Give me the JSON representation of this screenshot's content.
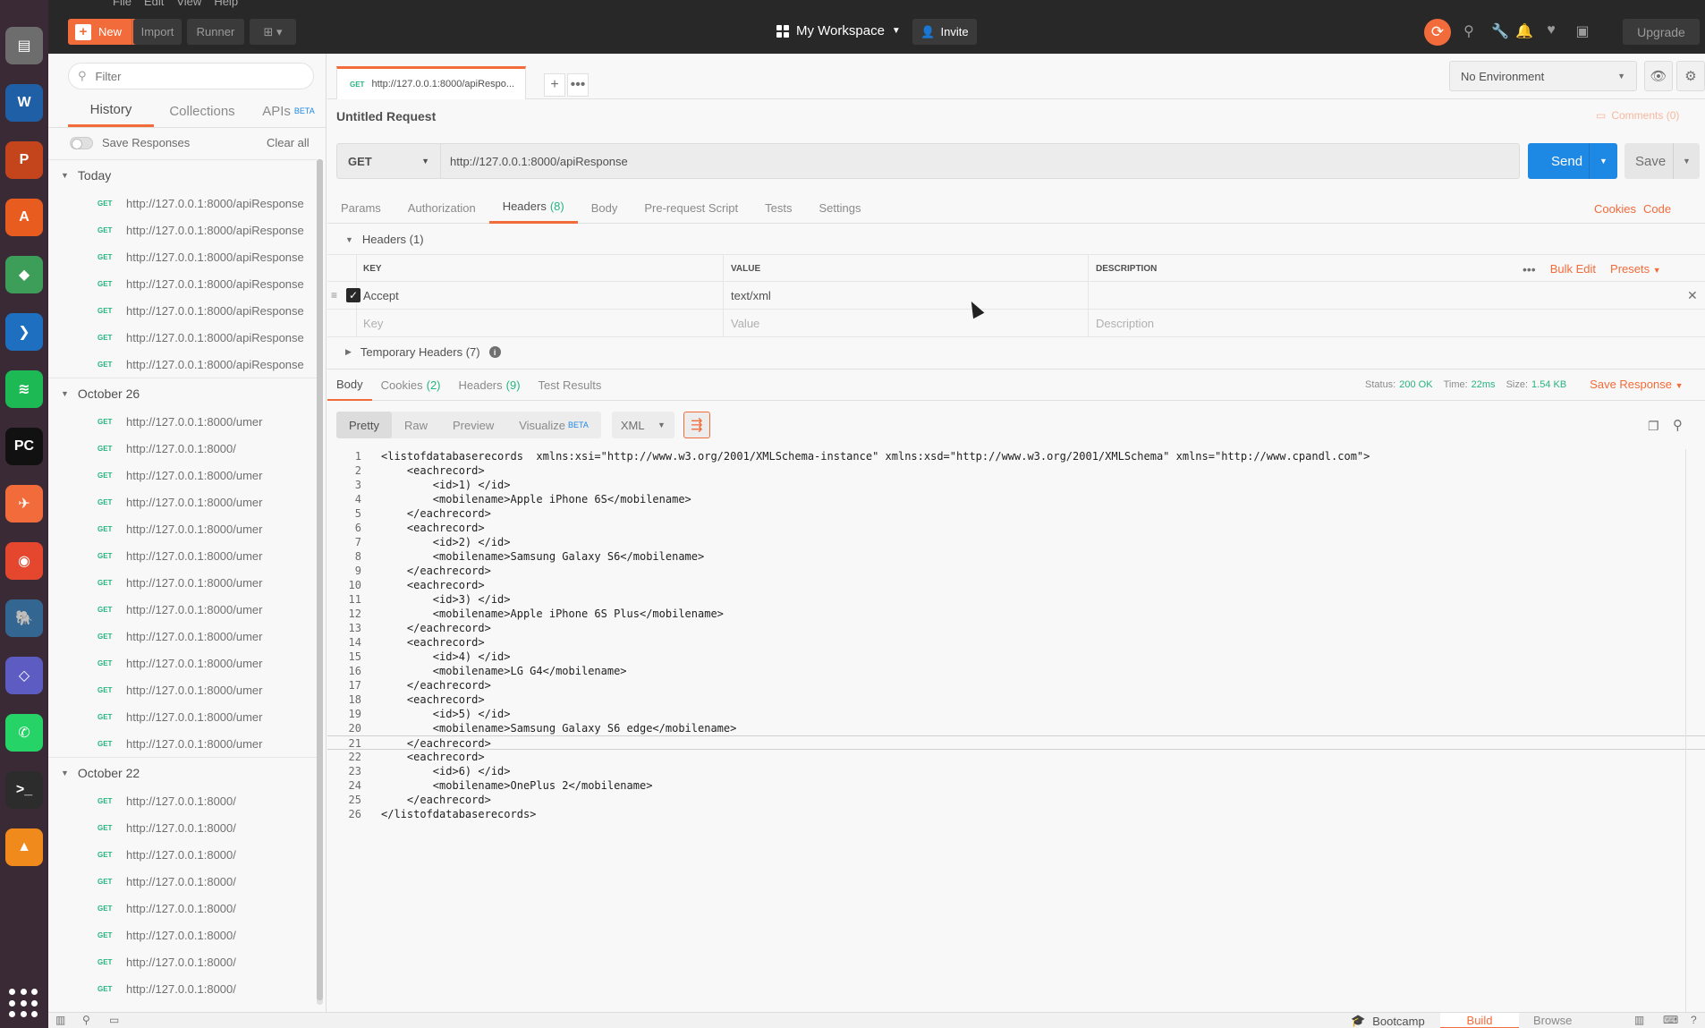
{
  "menu": [
    "File",
    "Edit",
    "View",
    "Help"
  ],
  "dock": [
    {
      "name": "files-icon",
      "color": "#6d6d6d",
      "glyph": "▤"
    },
    {
      "name": "writer-icon",
      "color": "#1f5fa6",
      "glyph": "W"
    },
    {
      "name": "impress-icon",
      "color": "#c4441c",
      "glyph": "P"
    },
    {
      "name": "software-center-icon",
      "color": "#e85c1f",
      "glyph": "A"
    },
    {
      "name": "android-studio-icon",
      "color": "#3d9e5a",
      "glyph": "◆"
    },
    {
      "name": "vscode-icon",
      "color": "#1f6fc0",
      "glyph": "❯"
    },
    {
      "name": "spotify-icon",
      "color": "#1db954",
      "glyph": "≋"
    },
    {
      "name": "pycharm-icon",
      "color": "#111111",
      "glyph": "PC"
    },
    {
      "name": "postman-icon",
      "color": "#f26b3a",
      "glyph": "✈"
    },
    {
      "name": "chrome-icon",
      "color": "#e5462e",
      "glyph": "◉"
    },
    {
      "name": "postgres-icon",
      "color": "#336791",
      "glyph": "🐘"
    },
    {
      "name": "git-icon",
      "color": "#5c5cc2",
      "glyph": "◇"
    },
    {
      "name": "whatsapp-icon",
      "color": "#25d366",
      "glyph": "✆"
    },
    {
      "name": "terminal-icon",
      "color": "#2c2c2c",
      "glyph": ">_"
    },
    {
      "name": "vlc-icon",
      "color": "#f08a1c",
      "glyph": "▲"
    }
  ],
  "toolbar": {
    "new_label": "New",
    "import_label": "Import",
    "runner_label": "Runner",
    "workspace_label": "My Workspace",
    "invite_label": "Invite",
    "upgrade_label": "Upgrade"
  },
  "sidebar": {
    "filter_placeholder": "Filter",
    "tabs": [
      {
        "label": "History"
      },
      {
        "label": "Collections"
      },
      {
        "label": "APIs",
        "badge": "BETA"
      }
    ],
    "save_responses_label": "Save Responses",
    "clear_all_label": "Clear all",
    "groups": [
      {
        "title": "Today",
        "items": [
          {
            "method": "GET",
            "url": "http://127.0.0.1:8000/apiResponse"
          },
          {
            "method": "GET",
            "url": "http://127.0.0.1:8000/apiResponse"
          },
          {
            "method": "GET",
            "url": "http://127.0.0.1:8000/apiResponse"
          },
          {
            "method": "GET",
            "url": "http://127.0.0.1:8000/apiResponse"
          },
          {
            "method": "GET",
            "url": "http://127.0.0.1:8000/apiResponse"
          },
          {
            "method": "GET",
            "url": "http://127.0.0.1:8000/apiResponse"
          },
          {
            "method": "GET",
            "url": "http://127.0.0.1:8000/apiResponse"
          }
        ]
      },
      {
        "title": "October 26",
        "items": [
          {
            "method": "GET",
            "url": "http://127.0.0.1:8000/umer"
          },
          {
            "method": "GET",
            "url": "http://127.0.0.1:8000/"
          },
          {
            "method": "GET",
            "url": "http://127.0.0.1:8000/umer"
          },
          {
            "method": "GET",
            "url": "http://127.0.0.1:8000/umer"
          },
          {
            "method": "GET",
            "url": "http://127.0.0.1:8000/umer"
          },
          {
            "method": "GET",
            "url": "http://127.0.0.1:8000/umer"
          },
          {
            "method": "GET",
            "url": "http://127.0.0.1:8000/umer"
          },
          {
            "method": "GET",
            "url": "http://127.0.0.1:8000/umer"
          },
          {
            "method": "GET",
            "url": "http://127.0.0.1:8000/umer"
          },
          {
            "method": "GET",
            "url": "http://127.0.0.1:8000/umer"
          },
          {
            "method": "GET",
            "url": "http://127.0.0.1:8000/umer"
          },
          {
            "method": "GET",
            "url": "http://127.0.0.1:8000/umer"
          },
          {
            "method": "GET",
            "url": "http://127.0.0.1:8000/umer"
          }
        ]
      },
      {
        "title": "October 22",
        "items": [
          {
            "method": "GET",
            "url": "http://127.0.0.1:8000/"
          },
          {
            "method": "GET",
            "url": "http://127.0.0.1:8000/"
          },
          {
            "method": "GET",
            "url": "http://127.0.0.1:8000/"
          },
          {
            "method": "GET",
            "url": "http://127.0.0.1:8000/"
          },
          {
            "method": "GET",
            "url": "http://127.0.0.1:8000/"
          },
          {
            "method": "GET",
            "url": "http://127.0.0.1:8000/"
          },
          {
            "method": "GET",
            "url": "http://127.0.0.1:8000/"
          },
          {
            "method": "GET",
            "url": "http://127.0.0.1:8000/"
          }
        ]
      }
    ]
  },
  "request": {
    "tab_method": "GET",
    "tab_title": "http://127.0.0.1:8000/apiRespo...",
    "name": "Untitled Request",
    "comments_label": "Comments (0)",
    "method": "GET",
    "url": "http://127.0.0.1:8000/apiResponse",
    "send_label": "Send",
    "save_label": "Save",
    "environment": "No Environment",
    "tabs": [
      {
        "label": "Params",
        "count": ""
      },
      {
        "label": "Authorization",
        "count": ""
      },
      {
        "label": "Headers",
        "count": "(8)"
      },
      {
        "label": "Body",
        "count": ""
      },
      {
        "label": "Pre-request Script",
        "count": ""
      },
      {
        "label": "Tests",
        "count": ""
      },
      {
        "label": "Settings",
        "count": ""
      }
    ],
    "cookies_link": "Cookies",
    "code_link": "Code",
    "headers_section": "Headers (1)",
    "headers_table": {
      "col_key": "KEY",
      "col_value": "VALUE",
      "col_description": "DESCRIPTION",
      "bulk_edit": "Bulk Edit",
      "presets": "Presets",
      "row": {
        "key": "Accept",
        "value": "text/xml",
        "checked": true
      },
      "placeholder_key": "Key",
      "placeholder_value": "Value",
      "placeholder_description": "Description"
    },
    "temporary_headers": "Temporary Headers (7)"
  },
  "response": {
    "tabs": [
      {
        "label": "Body",
        "count": ""
      },
      {
        "label": "Cookies",
        "count": "(2)"
      },
      {
        "label": "Headers",
        "count": "(9)"
      },
      {
        "label": "Test Results",
        "count": ""
      }
    ],
    "status_label": "Status:",
    "status_value": "200 OK",
    "time_label": "Time:",
    "time_value": "22ms",
    "size_label": "Size:",
    "size_value": "1.54 KB",
    "save_response_label": "Save Response",
    "formats": [
      {
        "label": "Pretty",
        "badge": ""
      },
      {
        "label": "Raw",
        "badge": ""
      },
      {
        "label": "Preview",
        "badge": ""
      },
      {
        "label": "Visualize",
        "badge": "BETA"
      }
    ],
    "language": "XML",
    "current_line": 21,
    "code_lines": [
      "<listofdatabaserecords  xmlns:xsi=\"http://www.w3.org/2001/XMLSchema-instance\" xmlns:xsd=\"http://www.w3.org/2001/XMLSchema\" xmlns=\"http://www.cpandl.com\">",
      "    <eachrecord>",
      "        <id>1) </id>",
      "        <mobilename>Apple iPhone 6S</mobilename>",
      "    </eachrecord>",
      "    <eachrecord>",
      "        <id>2) </id>",
      "        <mobilename>Samsung Galaxy S6</mobilename>",
      "    </eachrecord>",
      "    <eachrecord>",
      "        <id>3) </id>",
      "        <mobilename>Apple iPhone 6S Plus</mobilename>",
      "    </eachrecord>",
      "    <eachrecord>",
      "        <id>4) </id>",
      "        <mobilename>LG G4</mobilename>",
      "    </eachrecord>",
      "    <eachrecord>",
      "        <id>5) </id>",
      "        <mobilename>Samsung Galaxy S6 edge</mobilename>",
      "    </eachrecord>",
      "    <eachrecord>",
      "        <id>6) </id>",
      "        <mobilename>OnePlus 2</mobilename>",
      "    </eachrecord>",
      "</listofdatabaserecords>"
    ]
  },
  "statusbar": {
    "bootcamp_label": "Bootcamp",
    "build_label": "Build",
    "browse_label": "Browse"
  },
  "colors": {
    "accent": "#f26b3a",
    "send_blue": "#1e88e5",
    "method_green": "#26b47f"
  }
}
